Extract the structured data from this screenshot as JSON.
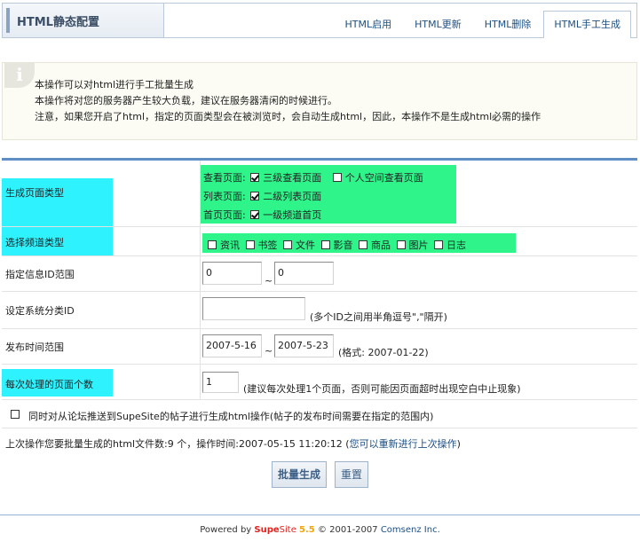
{
  "header": {
    "title": "HTML静态配置",
    "tabs": [
      "HTML启用",
      "HTML更新",
      "HTML删除",
      "HTML手工生成"
    ]
  },
  "info": {
    "icon": "i",
    "lines": [
      "本操作可以对html进行手工批量生成",
      "本操作将对您的服务器产生较大负载，建议在服务器清闲的时候进行。",
      "注意，如果您开启了html，指定的页面类型会在被浏览时，会自动生成html，因此，本操作不是生成html必需的操作"
    ]
  },
  "form": {
    "page_type": {
      "label": "生成页面类型",
      "view_label": "查看页面:",
      "view_opt1": "三级查看页面",
      "view_opt2": "个人空间查看页面",
      "list_label": "列表页面:",
      "list_opt1": "二级列表页面",
      "home_label": "首页页面:",
      "home_opt1": "一级频道首页"
    },
    "channel": {
      "label": "选择频道类型",
      "options": [
        "资讯",
        "书签",
        "文件",
        "影音",
        "商品",
        "图片",
        "日志"
      ]
    },
    "id_range": {
      "label": "指定信息ID范围",
      "from": "0",
      "sep": "~",
      "to": "0"
    },
    "category": {
      "label": "设定系统分类ID",
      "value": "",
      "hint": "(多个ID之间用半角逗号\",\"隔开)"
    },
    "time_range": {
      "label": "发布时间范围",
      "from": "2007-5-16",
      "sep": "~",
      "to": "2007-5-23",
      "hint": "(格式: 2007-01-22)"
    },
    "per_page": {
      "label": "每次处理的页面个数",
      "value": "1",
      "hint": "(建议每次处理1个页面，否则可能因页面超时出现空白中止现象)"
    },
    "forum_sync": {
      "label": "同时对从论坛推送到SupeSite的帖子进行生成html操作(帖子的发布时间需要在指定的范围内)"
    },
    "last_op": {
      "text": "上次操作您要批量生成的html文件数:9 个，操作时间:2007-05-15 11:20:12 (",
      "link": "您可以重新进行上次操作",
      "close": ")"
    }
  },
  "buttons": {
    "submit": "批量生成",
    "reset": "重置"
  },
  "footer": {
    "powered": "Powered by ",
    "brand_a": "Supe",
    "brand_b": "Site",
    "version": "5.5",
    "copy": " © 2001-2007 ",
    "company": "Comsenz Inc."
  }
}
